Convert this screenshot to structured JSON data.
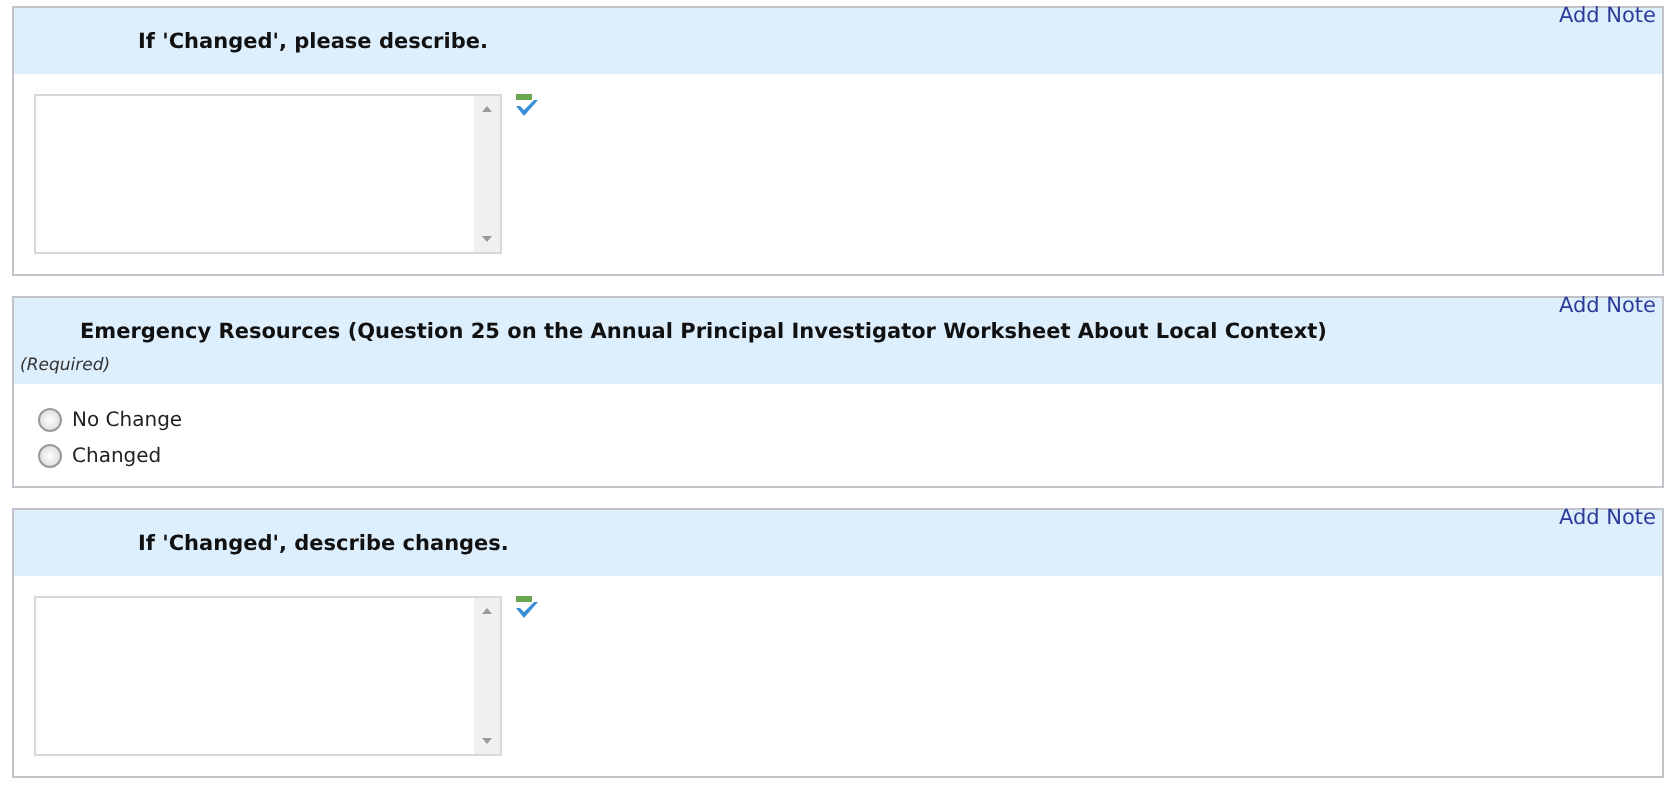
{
  "panels": [
    {
      "kind": "textarea",
      "title": "If 'Changed', please describe.",
      "note_link": "Add Note"
    },
    {
      "kind": "radio",
      "title": "Emergency Resources (Question 25 on the Annual Principal Investigator Worksheet About Local Context)",
      "required": "(Required)",
      "note_link": "Add Note",
      "options": [
        {
          "label": "No Change",
          "selected": false
        },
        {
          "label": "Changed",
          "selected": false
        }
      ]
    },
    {
      "kind": "textarea",
      "title": "If 'Changed', describe changes.",
      "note_link": "Add Note"
    }
  ]
}
